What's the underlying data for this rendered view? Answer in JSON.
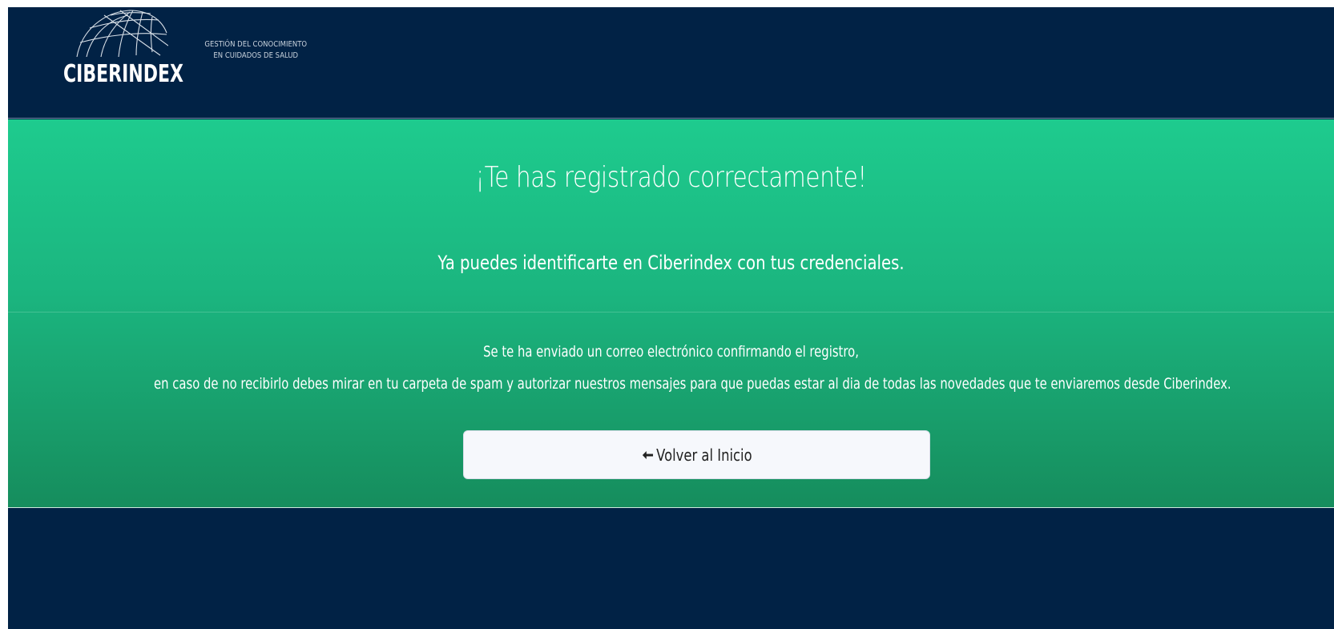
{
  "header": {
    "logo_text": "CIBERINDEX",
    "tagline_line1": "GESTIÓN DEL CONOCIMIENTO",
    "tagline_line2": "EN CUIDADOS DE SALUD"
  },
  "success": {
    "title": "¡Te has registrado correctamente!",
    "subtitle": "Ya puedes identificarte en Ciberindex con tus credenciales.",
    "message_line1": "Se te ha enviado un correo electrónico confirmando el registro,",
    "message_line2": "en caso de no recibirlo debes mirar en tu carpeta de spam y autorizar nuestros mensajes para que puedas estar al dia de todas las novedades que te enviaremos desde Ciberindex."
  },
  "actions": {
    "back_label": "Volver al Inicio",
    "back_icon": "arrow-left-icon"
  },
  "colors": {
    "navy": "#012245",
    "green_top": "#1ecb8e",
    "green_bottom": "#168d5d",
    "button_bg": "#f6f8fc"
  }
}
